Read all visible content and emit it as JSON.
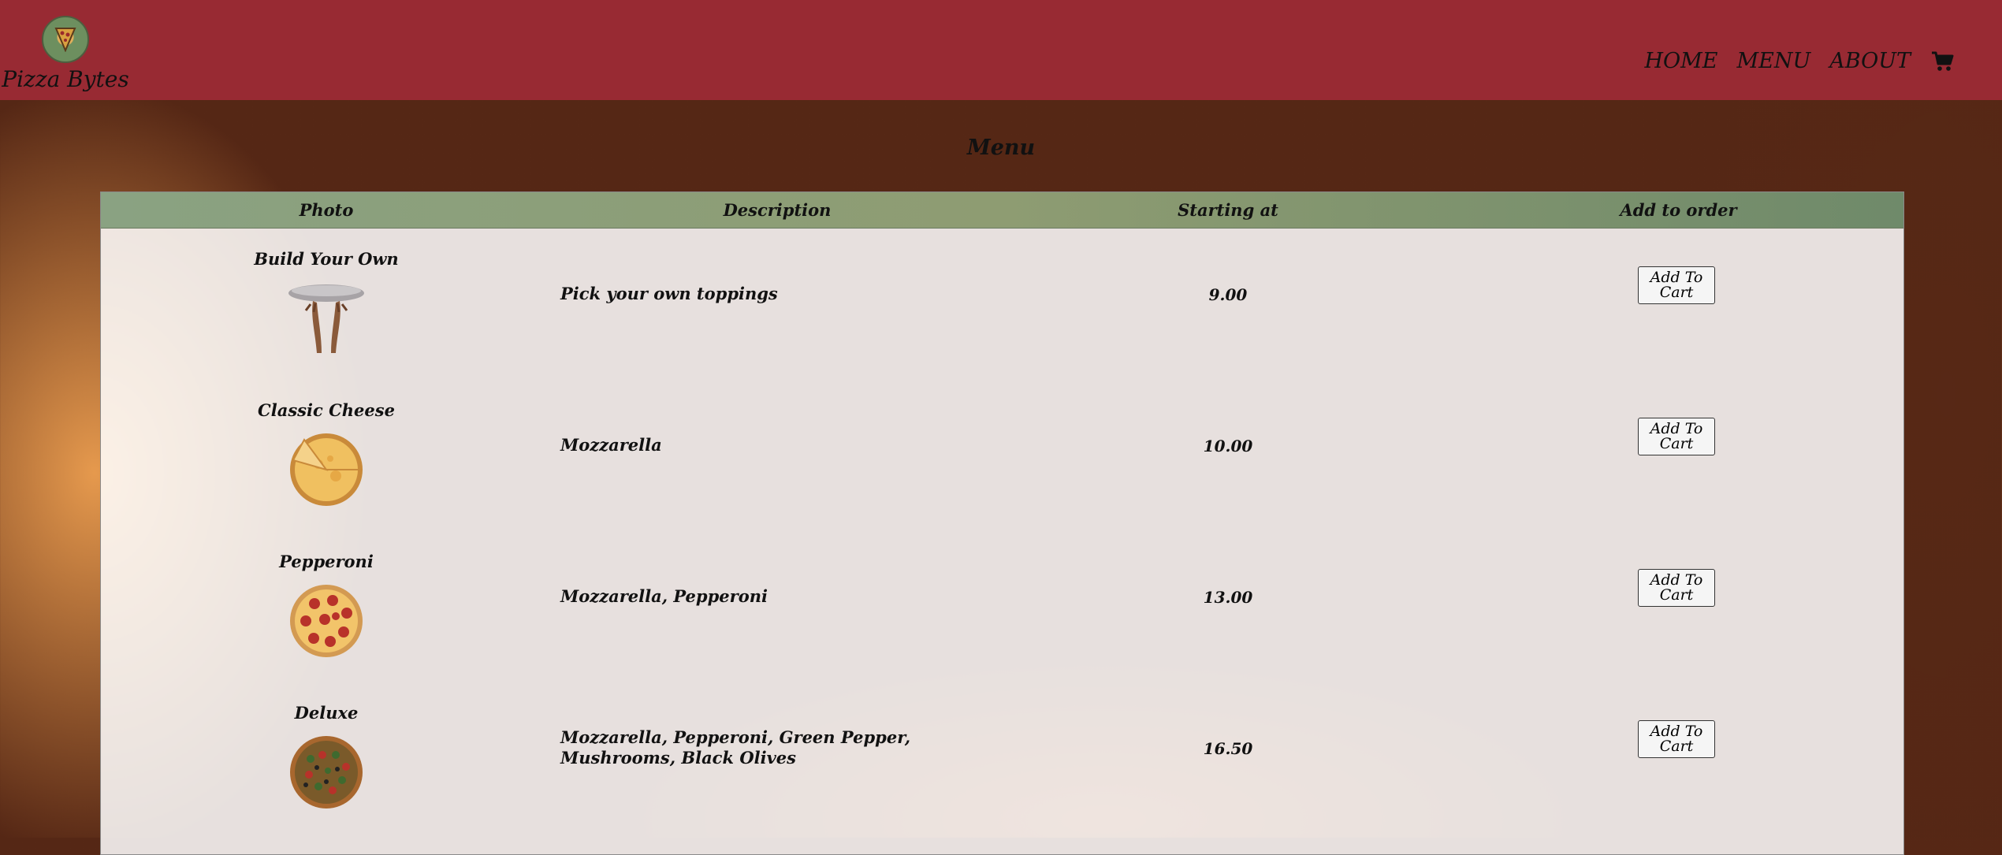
{
  "brand": {
    "name": "Pizza Bytes",
    "logo_icon": "pizza-slice-logo"
  },
  "nav": {
    "home": "HOME",
    "menu": "MENU",
    "about": "ABOUT",
    "cart_icon": "shopping-cart-icon"
  },
  "page": {
    "title": "Menu"
  },
  "table": {
    "headers": {
      "photo": "Photo",
      "description": "Description",
      "price": "Starting at",
      "order": "Add to order"
    },
    "items": [
      {
        "name": "Build Your Own",
        "description": "Pick your own toppings",
        "price": "9.00",
        "button": "Add To Cart",
        "photo": "dough-hands"
      },
      {
        "name": "Classic Cheese",
        "description": "Mozzarella",
        "price": "10.00",
        "button": "Add To Cart",
        "photo": "cheese-pizza"
      },
      {
        "name": "Pepperoni",
        "description": "Mozzarella, Pepperoni",
        "price": "13.00",
        "button": "Add To Cart",
        "photo": "pepperoni-pizza"
      },
      {
        "name": "Deluxe",
        "description": "Mozzarella, Pepperoni, Green Pepper, Mushrooms, Black Olives",
        "price": "16.50",
        "button": "Add To Cart",
        "photo": "deluxe-pizza"
      }
    ]
  },
  "colors": {
    "navbar": "#982a33",
    "table_header": "#8aa282"
  }
}
